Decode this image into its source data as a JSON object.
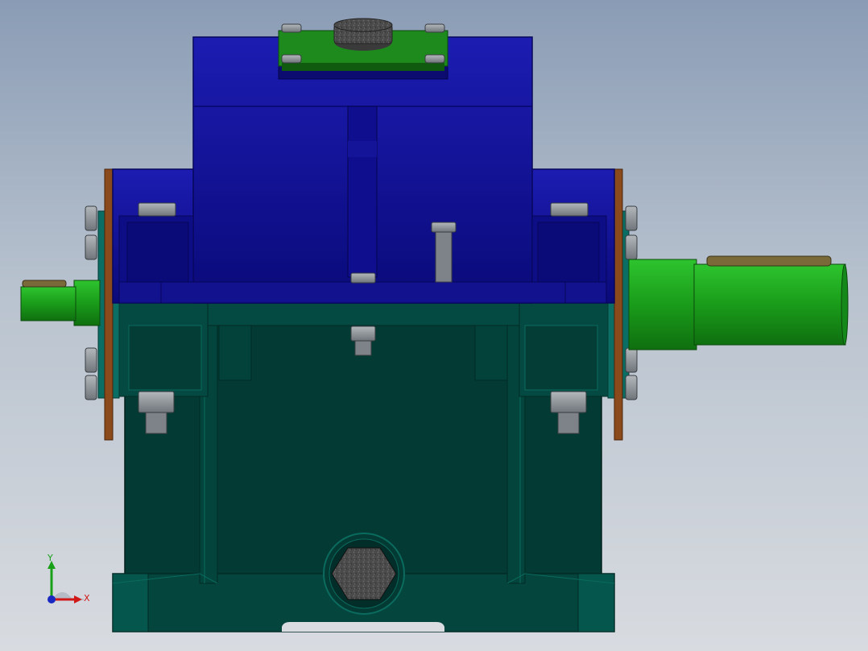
{
  "viewport": {
    "background_top": "#8a9cb5",
    "background_bottom": "#d8dbe0"
  },
  "model": {
    "parts": {
      "upper_housing": {
        "color": "#1a1aa8"
      },
      "lower_housing": {
        "color": "#04403a"
      },
      "output_shaft": {
        "color": "#1fa51f"
      },
      "input_shaft": {
        "color": "#1fa51f"
      },
      "inspection_cover": {
        "color": "#1e8a1e"
      },
      "bearing_cap_ring": {
        "color": "#8b4a1c"
      },
      "fasteners": {
        "color": "#8e949a"
      }
    }
  },
  "triad": {
    "x_label": "X",
    "y_label": "Y",
    "x_color": "#d01818",
    "y_color": "#18a018",
    "z_color": "#1828c0"
  }
}
